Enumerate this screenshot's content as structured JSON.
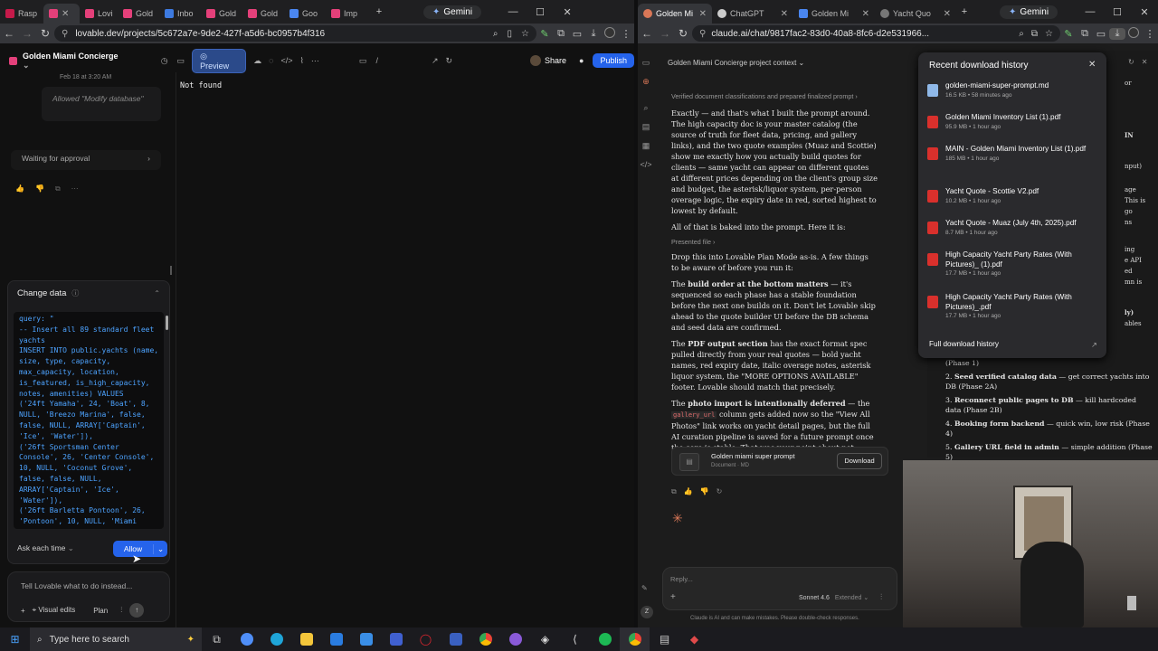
{
  "left": {
    "tabs": [
      "Rasp",
      "",
      "Lovi",
      "Gold",
      "Inbo",
      "Gold",
      "Gold",
      "Goo",
      "Imp"
    ],
    "gemini": "Gemini",
    "url": "lovable.dev/projects/5c672a7e-9de2-427f-a5d6-bc0957b4f316",
    "project_name": "Golden Miami Concierge",
    "preview_label": "Preview",
    "path_value": "/",
    "share_label": "Share",
    "publish_label": "Publish",
    "not_found": "Not found",
    "chat": {
      "timestamp": "Feb 18 at 3:20 AM",
      "allowed_msg": "Allowed \"Modify database\"",
      "waiting": "Waiting for approval",
      "change_data_title": "Change data",
      "query_text": "query: \"\n-- Insert all 89 standard fleet\nyachts\nINSERT INTO public.yachts (name,\nsize, type, capacity,\nmax_capacity, location,\nis_featured, is_high_capacity,\nnotes, amenities) VALUES\n('24ft Yamaha', 24, 'Boat', 8,\nNULL, 'Breezo Marina', false,\nfalse, NULL, ARRAY['Captain',\n'Ice', 'Water']),\n('26ft Sportsman Center\nConsole', 26, 'Center Console',\n10, NULL, 'Coconut Grove',\nfalse, false, NULL,\nARRAY['Captain', 'Ice',\n'Water']),\n('26ft Barletta Pontoon', 26,\n'Pontoon', 10, NULL, 'Miami\nRiver', false, false, NULL,",
      "ask_label": "Ask each time",
      "allow_label": "Allow",
      "input_placeholder": "Tell Lovable what to do instead...",
      "visual_edits": "Visual edits",
      "plan": "Plan"
    }
  },
  "right": {
    "tabs": [
      "Golden Mi",
      "ChatGPT",
      "Golden Mi",
      "Yacht Quo"
    ],
    "gemini": "Gemini",
    "url": "claude.ai/chat/9817fac2-83d0-40a8-8fc6-d2e531966...",
    "project_context": "Golden Miami Concierge project context",
    "verified_line": "Verified document classifications and prepared finalized prompt",
    "para1": "Exactly — and that's what I built the prompt around. The high capacity doc is your master catalog (the source of truth for fleet data, pricing, and gallery links), and the two quote examples (Muaz and Scottie) show me exactly how you actually build quotes for clients — same yacht can appear on different quotes at different prices depending on the client's group size and budget, the asterisk/liquor system, per-person overage logic, the expiry date in red, sorted highest to lowest by default.",
    "para2": "All of that is baked into the prompt. Here it is:",
    "presented_file": "Presented file",
    "para3": "Drop this into Lovable Plan Mode as-is. A few things to be aware of before you run it:",
    "p4_bold": "build order at the bottom matters",
    "p4_pre": "The ",
    "p4_rest": " — it's sequenced so each phase has a stable foundation before the next one builds on it. Don't let Lovable skip ahead to the quote builder UI before the DB schema and seed data are confirmed.",
    "p5_pre": "The ",
    "p5_bold": "PDF output section",
    "p5_rest": " has the exact format spec pulled directly from your real quotes — bold yacht names, red expiry date, italic overage notes, asterisk liquor system, the \"MORE OPTIONS AVAILABLE\" footer. Lovable should match that precisely.",
    "p6_pre": "The ",
    "p6_bold": "photo import is intentionally deferred",
    "p6_mid": " — the ",
    "p6_code": "gallery_url",
    "p6_rest": " column gets added now so the \"View All Photos\" link works on yacht detail pages, but the full AI curation pipeline is saved for a future prompt once the core is stable. That was your point about not making things hard to fix later.",
    "file_name": "Golden miami super prompt",
    "file_type": "Document · MD",
    "download_label": "Download",
    "reply_placeholder": "Reply...",
    "model": "Sonnet 4.6",
    "extended": "Extended",
    "disclaimer": "Claude is AI and can make mistakes. Please double-check responses.",
    "downloads": {
      "title": "Recent download history",
      "items": [
        {
          "name": "golden-miami-super-prompt.md",
          "meta": "16.5 KB • 58 minutes ago"
        },
        {
          "name": "Golden Miami Inventory List (1).pdf",
          "meta": "95.9 MB • 1 hour ago"
        },
        {
          "name": "MAIN - Golden Miami Inventory List (1).pdf",
          "meta": "185 MB • 1 hour ago"
        },
        {
          "name": "Yacht Quote - Scottie V2.pdf",
          "meta": "10.2 MB • 1 hour ago"
        },
        {
          "name": "Yacht Quote - Muaz (July 4th, 2025).pdf",
          "meta": "8.7 MB • 1 hour ago"
        },
        {
          "name": "High Capacity Yacht Party Rates (With Pictures)_ (1).pdf",
          "meta": "17.7 MB • 1 hour ago"
        },
        {
          "name": "High Capacity Yacht Party Rates (With Pictures)_.pdf",
          "meta": "17.7 MB • 1 hour ago"
        }
      ],
      "full_history": "Full download history"
    },
    "behind_list": [
      {
        "text": "(Phase 1)",
        "bold": ""
      },
      {
        "num": "2.",
        "bold": "Seed verified catalog data",
        "text": " — get correct yachts into DB (Phase 2A)"
      },
      {
        "num": "3.",
        "bold": "Reconnect public pages to DB",
        "text": " — kill hardcoded data (Phase 2B)"
      },
      {
        "num": "4.",
        "bold": "Booking form backend",
        "text": " — quick win, low risk (Phase 4)"
      },
      {
        "num": "5.",
        "bold": "Gallery URL field in admin",
        "text": " — simple addition (Phase 5)"
      }
    ],
    "behind_fragments": [
      "or",
      "IN",
      "nput)",
      "age",
      "This is",
      "go",
      "ns",
      "ing",
      "e API",
      "ed",
      "mn is",
      "ly)",
      "ables"
    ]
  },
  "taskbar": {
    "search_placeholder": "Type here to search"
  }
}
